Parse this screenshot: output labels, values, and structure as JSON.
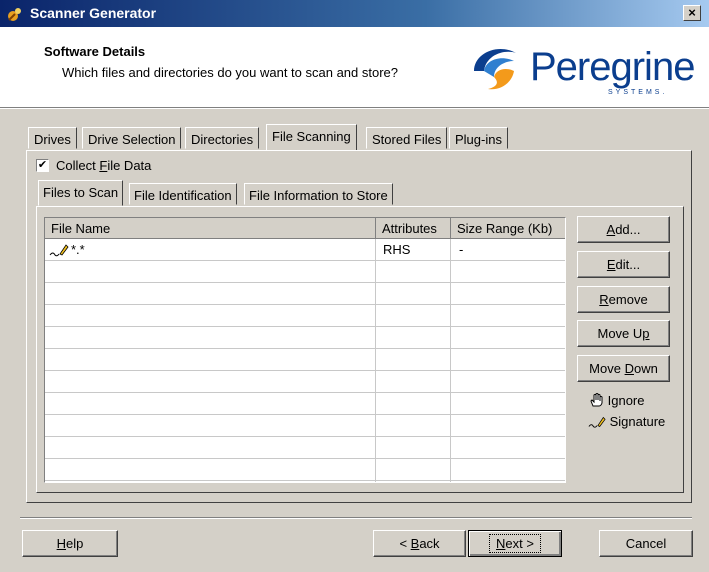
{
  "window": {
    "title": "Scanner Generator",
    "close_glyph": "×"
  },
  "header": {
    "title": "Software Details",
    "subtitle": "Which files and directories do you want to scan and store?",
    "logo_text": "Peregrine",
    "logo_sub": "SYSTEMS."
  },
  "tabs": [
    {
      "label": "Drives"
    },
    {
      "label": "Drive Selection"
    },
    {
      "label": "Directories"
    },
    {
      "label": "File Scanning",
      "active": true
    },
    {
      "label": "Stored Files"
    },
    {
      "label": "Plug-ins"
    }
  ],
  "collect": {
    "checked_glyph": "✔",
    "label_pre": "Collect ",
    "label_u": "F",
    "label_post": "ile Data"
  },
  "subtabs": [
    {
      "label": "Files to Scan",
      "active": true
    },
    {
      "label": "File Identification"
    },
    {
      "label": "File Information to Store"
    }
  ],
  "table": {
    "columns": [
      "File Name",
      "Attributes",
      "Size Range (Kb)"
    ],
    "rows": [
      {
        "icon": "signature-icon",
        "name": "*.*",
        "attributes": "RHS",
        "size_range": "-"
      }
    ]
  },
  "side_buttons": [
    {
      "u": "A",
      "rest": "dd...",
      "pre": ""
    },
    {
      "u": "E",
      "rest": "dit...",
      "pre": ""
    },
    {
      "u": "R",
      "rest": "emove",
      "pre": ""
    },
    {
      "pre": "Move U",
      "u": "p",
      "rest": ""
    },
    {
      "pre": "Move ",
      "u": "D",
      "rest": "own"
    }
  ],
  "legend": {
    "ignore": "Ignore",
    "signature": "Signature"
  },
  "footer": {
    "help": {
      "u": "H",
      "rest": "elp"
    },
    "back": {
      "pre": "< ",
      "u": "B",
      "rest": "ack"
    },
    "next": {
      "u": "N",
      "rest": "ext >"
    },
    "cancel": "Cancel"
  },
  "colors": {
    "title_bar": "#0a246a",
    "face": "#d4d0c8",
    "logo_blue": "#0b3e8e",
    "logo_orange": "#f39a1b"
  }
}
